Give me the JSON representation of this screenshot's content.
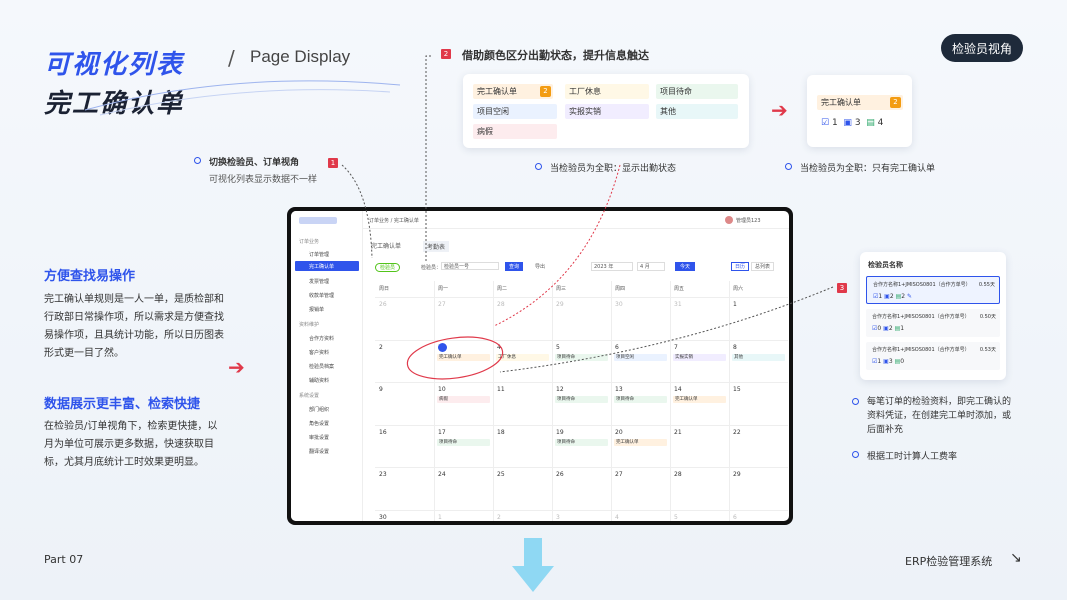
{
  "header": {
    "title_line1": "可视化列表",
    "title_line2": "完工确认单",
    "subtitle": "Page Display",
    "role_button": "检验员视角"
  },
  "callout1": {
    "num": "1",
    "title": "切换检验员、订单视角",
    "desc": "可视化列表显示数据不一样"
  },
  "callout2": {
    "num": "2",
    "title": "借助颜色区分出勤状态，提升信息触达"
  },
  "callout3": {
    "num": "3"
  },
  "status_card": {
    "chips": [
      {
        "label": "完工确认单",
        "count": "2",
        "color": "#fff1e0"
      },
      {
        "label": "工厂休息",
        "color": "#fff8e6"
      },
      {
        "label": "项目待命",
        "color": "#eaf7ee"
      },
      {
        "label": "项目空闲",
        "color": "#eaf2ff"
      },
      {
        "label": "实报实销",
        "color": "#f1edff"
      },
      {
        "label": "其他",
        "color": "#e8f7f8"
      },
      {
        "label": "病假",
        "color": "#fdecee"
      }
    ],
    "note": "当检验员为全职：显示出勤状态"
  },
  "small_card": {
    "chip": "完工确认单",
    "count": "2",
    "stats": [
      "1",
      "3",
      "4"
    ],
    "note": "当检验员为全职：只有完工确认单"
  },
  "left": {
    "h1": "方便查找易操作",
    "p1": "完工确认单规则是一人一单，是质检部和行政部日常操作项，所以需求是方便查找易操作项，且具统计功能，所以日历图表形式更一目了然。",
    "h2": "数据展示更丰富、检索快捷",
    "p2": "在检验员/订单视角下，检索更快捷，以月为单位可展示更多数据，快速获取目标，尤其月底统计工时效果更明显。"
  },
  "inspector_card": {
    "title": "检验员名称",
    "rows": [
      {
        "name": "合作方名称1+JMISOS0801（合作方单号）",
        "days": "0.55天",
        "stats": [
          "1",
          "2",
          "2"
        ]
      },
      {
        "name": "合作方名称1+JMISOS0801（合作方单号）",
        "days": "0.50天",
        "stats": [
          "0",
          "2",
          "1"
        ]
      },
      {
        "name": "合作方名称1+JMISOS0801（合作方单号）",
        "days": "0.53天",
        "stats": [
          "1",
          "3",
          "0"
        ]
      }
    ]
  },
  "right_notes": [
    "每笔订单的检验资料，即完工确认的资料凭证，在创建完工单时添加，或后面补充",
    "根据工时计算人工费率"
  ],
  "footer": {
    "left": "Part 07",
    "right": "ERP检验管理系统"
  },
  "app": {
    "breadcrumb": "订单业务 / 完工确认单",
    "user": "管理员123",
    "tabs": [
      "完工确认单",
      "考勤表"
    ],
    "sidebar": [
      "订单业务",
      "订单管理",
      "完工确认单",
      "发票管理",
      "收款单管理",
      "报销单",
      "资料维护",
      "合作方资料",
      "客户资料",
      "检验员档案",
      "辅助资料",
      "系统设置",
      "部门组织",
      "角色设置",
      "审批设置",
      "翻译设置"
    ],
    "filter": {
      "tag": "检验员",
      "label": "检验员：",
      "value": "检验员一号",
      "search": "查询",
      "export": "导出",
      "year": "2023 年",
      "month": "4 月",
      "today": "今天",
      "view1": "日历",
      "view2": "总列表"
    },
    "weekdays": [
      "周日",
      "周一",
      "周二",
      "周三",
      "周四",
      "周五",
      "周六"
    ],
    "weeks": [
      [
        "26",
        "27",
        "28",
        "29",
        "30",
        "31",
        "1"
      ],
      [
        "2",
        "3",
        "4",
        "5",
        "6",
        "7",
        "8"
      ],
      [
        "9",
        "10",
        "11",
        "12",
        "13",
        "14",
        "15"
      ],
      [
        "16",
        "17",
        "18",
        "19",
        "20",
        "21",
        "22"
      ],
      [
        "23",
        "24",
        "25",
        "26",
        "27",
        "28",
        "29"
      ],
      [
        "30",
        "1",
        "2",
        "3",
        "4",
        "5",
        "6"
      ]
    ]
  }
}
